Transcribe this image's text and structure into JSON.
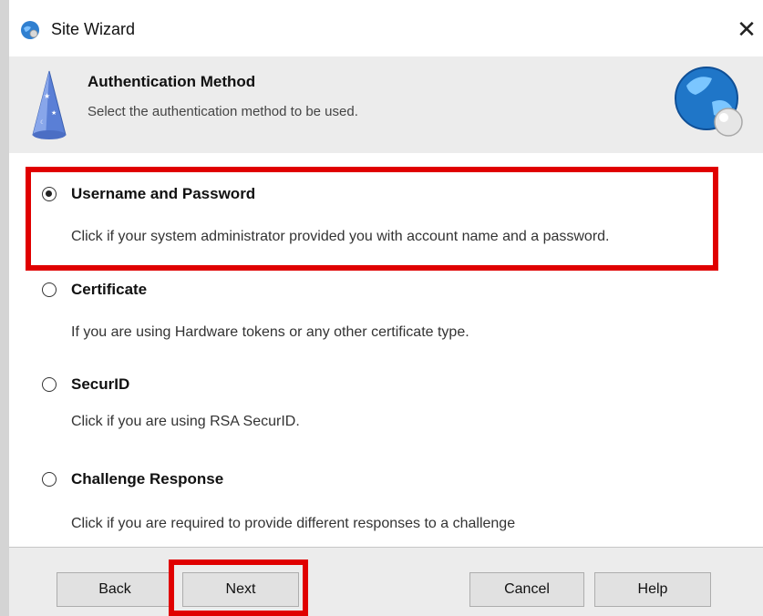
{
  "window": {
    "title": "Site Wizard",
    "close_glyph": "✕"
  },
  "header": {
    "title": "Authentication Method",
    "subtitle": "Select the authentication method to be used."
  },
  "options": [
    {
      "label": "Username and Password",
      "description": "Click if your system administrator provided you with account name and a password.",
      "selected": true
    },
    {
      "label": "Certificate",
      "description": "If you are using Hardware tokens or any other certificate type.",
      "selected": false
    },
    {
      "label": "SecurID",
      "description": "Click if you are using RSA SecurID.",
      "selected": false
    },
    {
      "label": "Challenge Response",
      "description": "Click if you are required to provide different responses to a challenge",
      "selected": false
    }
  ],
  "buttons": {
    "back": "Back",
    "next": "Next",
    "cancel": "Cancel",
    "help": "Help"
  },
  "colors": {
    "highlight": "#e00000",
    "header_bg": "#ececec",
    "button_bg": "#e1e1e1"
  },
  "icons": {
    "app": "site-wizard-globe-icon",
    "header_left": "wizard-hat-icon",
    "header_right": "globe-icon",
    "close": "close-icon"
  }
}
